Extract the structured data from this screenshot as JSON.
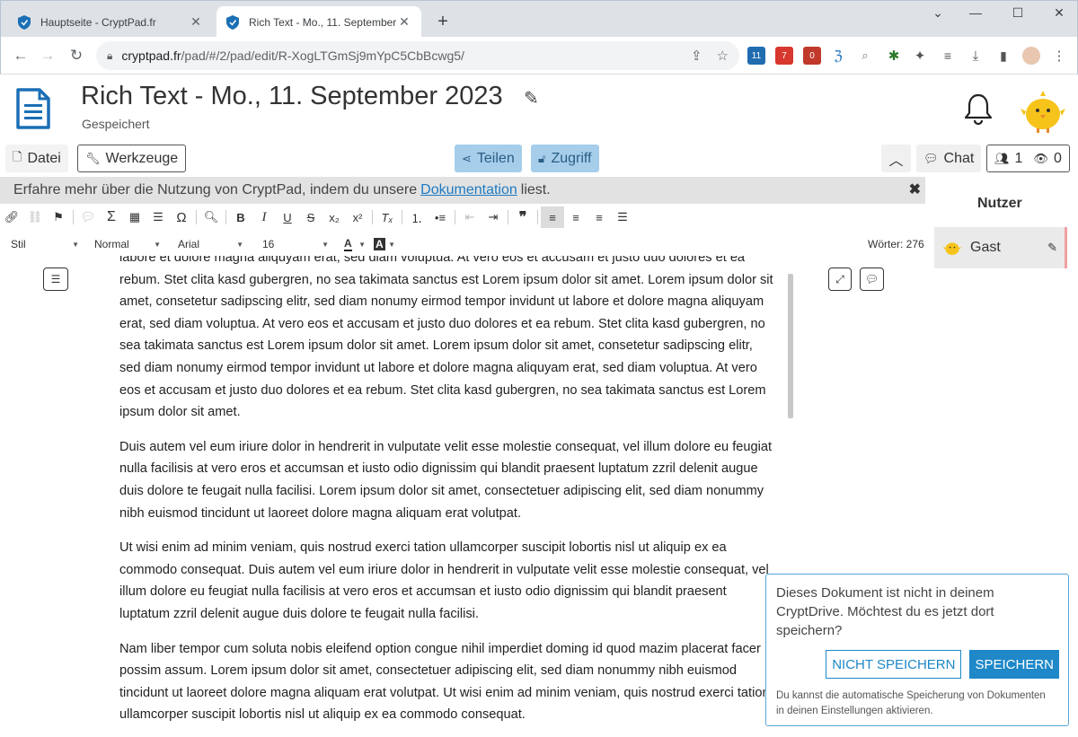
{
  "browser": {
    "tabs": [
      {
        "title": "Hauptseite - CryptPad.fr",
        "active": false
      },
      {
        "title": "Rich Text - Mo., 11. September 2023",
        "active": true
      }
    ],
    "new_tab": "+",
    "url_host": "cryptpad.fr",
    "url_path": "/pad/#/2/pad/edit/R-XogLTGmSj9mYpC5CbBcwg5/",
    "ext_badges": {
      "badge1": "11",
      "badge2": "7",
      "badge3": "0"
    }
  },
  "app": {
    "title": "Rich Text - Mo., 11. September 2023",
    "status": "Gespeichert"
  },
  "toolbar": {
    "file": "Datei",
    "tools": "Werkzeuge",
    "share": "Teilen",
    "access": "Zugriff",
    "chat": "Chat",
    "users_count": "1",
    "viewers_count": "0"
  },
  "banner": {
    "text_before": "Erfahre mehr über die Nutzung von CryptPad, indem du unsere",
    "link": "Dokumentation",
    "text_after": "liest."
  },
  "editor_toolbar": {
    "style": "Stil",
    "format": "Normal",
    "font": "Arial",
    "size": "16",
    "word_count": "Wörter: 276"
  },
  "users_panel": {
    "title": "Nutzer",
    "user_name": "Gast"
  },
  "document": {
    "paragraphs": [
      "labore et dolore magna aliquyam erat, sed diam voluptua. At vero eos et accusam et justo duo dolores et ea rebum. Stet clita kasd gubergren, no sea takimata sanctus est Lorem ipsum dolor sit amet. Lorem ipsum dolor sit amet, consetetur sadipscing elitr, sed diam nonumy eirmod tempor invidunt ut labore et dolore magna aliquyam erat, sed diam voluptua. At vero eos et accusam et justo duo dolores et ea rebum. Stet clita kasd gubergren, no sea takimata sanctus est Lorem ipsum dolor sit amet. Lorem ipsum dolor sit amet, consetetur sadipscing elitr, sed diam nonumy eirmod tempor invidunt ut labore et dolore magna aliquyam erat, sed diam voluptua. At vero eos et accusam et justo duo dolores et ea rebum. Stet clita kasd gubergren, no sea takimata sanctus est Lorem ipsum dolor sit amet.",
      "Duis autem vel eum iriure dolor in hendrerit in vulputate velit esse molestie consequat, vel illum dolore eu feugiat nulla facilisis at vero eros et accumsan et iusto odio dignissim qui blandit praesent luptatum zzril delenit augue duis dolore te feugait nulla facilisi. Lorem ipsum dolor sit amet, consectetuer adipiscing elit, sed diam nonummy nibh euismod tincidunt ut laoreet dolore magna aliquam erat volutpat.",
      "Ut wisi enim ad minim veniam, quis nostrud exerci tation ullamcorper suscipit lobortis nisl ut aliquip ex ea commodo consequat. Duis autem vel eum iriure dolor in hendrerit in vulputate velit esse molestie consequat, vel illum dolore eu feugiat nulla facilisis at vero eros et accumsan et iusto odio dignissim qui blandit praesent luptatum zzril delenit augue duis dolore te feugait nulla facilisi.",
      "Nam liber tempor cum soluta nobis eleifend option congue nihil imperdiet doming id quod mazim placerat facer possim assum. Lorem ipsum dolor sit amet, consectetuer adipiscing elit, sed diam nonummy nibh euismod tincidunt ut laoreet dolore magna aliquam erat volutpat. Ut wisi enim ad minim veniam, quis nostrud exerci tation ullamcorper suscipit lobortis nisl ut aliquip ex ea commodo consequat."
    ]
  },
  "save_popup": {
    "message": "Dieses Dokument ist nicht in deinem CryptDrive. Möchtest du es jetzt dort speichern?",
    "dont_save": "NICHT SPEICHERN",
    "save": "SPEICHERN",
    "note": "Du kannst die automatische Speicherung von Dokumenten in deinen Einstellungen aktivieren."
  },
  "colors": {
    "accent_blue": "#1e88c8",
    "share_button_bg": "#a6cdea",
    "cryptpad_icon": "#1b6fb5",
    "chick_yellow": "#f6c31a"
  }
}
